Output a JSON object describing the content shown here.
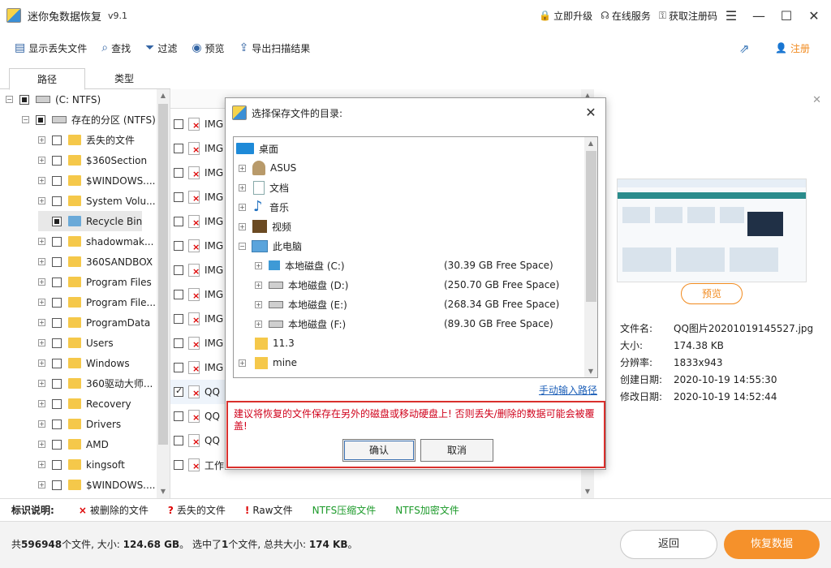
{
  "app": {
    "title": "迷你兔数据恢复",
    "version": "v9.1",
    "actions": [
      {
        "label": "立即升级",
        "icon": "lock-icon"
      },
      {
        "label": "在线服务",
        "icon": "headset-icon"
      },
      {
        "label": "获取注册码",
        "icon": "key-icon"
      }
    ]
  },
  "toolbar": {
    "show_lost": "显示丢失文件",
    "find": "查找",
    "filter": "过滤",
    "preview": "预览",
    "export": "导出扫描结果",
    "register": "注册"
  },
  "tabs": {
    "path": "路径",
    "type": "类型"
  },
  "tree": {
    "root": "(C: NTFS)",
    "partition": "存在的分区 (NTFS)",
    "items": [
      "丢失的文件",
      "$360Section",
      "$WINDOWS....",
      "System Volu...",
      "Recycle Bin",
      "shadowmak...",
      "360SANDBOX",
      "Program Files",
      "Program File...",
      "ProgramData",
      "Users",
      "Windows",
      "360驱动大师...",
      "Recovery",
      "Drivers",
      "AMD",
      "kingsoft",
      "$WINDOWS...."
    ]
  },
  "filelist": {
    "rows": [
      "IMG",
      "IMG",
      "IMG",
      "IMG",
      "IMG",
      "IMG",
      "IMG",
      "IMG",
      "IMG",
      "IMG",
      "IMG",
      "QQ",
      "QQ",
      "QQ",
      "工作"
    ]
  },
  "preview": {
    "button": "预览",
    "name_label": "文件名:",
    "name": "QQ图片20201019145527.jpg",
    "size_label": "大小:",
    "size": "174.38 KB",
    "res_label": "分辨率:",
    "res": "1833x943",
    "created_label": "创建日期:",
    "created": "2020-10-19 14:55:30",
    "modified_label": "修改日期:",
    "modified": "2020-10-19 14:52:44"
  },
  "legend": {
    "title": "标识说明:",
    "deleted": "被删除的文件",
    "lost": "丢失的文件",
    "raw": "Raw文件",
    "ntfs_compressed": "NTFS压缩文件",
    "ntfs_encrypted": "NTFS加密文件"
  },
  "status": {
    "prefix": "共",
    "count": "596948",
    "mid1": "个文件, 大小:",
    "total_size": "124.68 GB",
    "mid2": "。 选中了",
    "selected": "1",
    "mid3": "个文件, 总共大小:",
    "selected_size": "174 KB",
    "suffix": "。"
  },
  "buttons": {
    "back": "返回",
    "recover": "恢复数据"
  },
  "dialog": {
    "title": "选择保存文件的目录:",
    "desktop": "桌面",
    "nodes": [
      "ASUS",
      "文档",
      "音乐",
      "视频",
      "此电脑"
    ],
    "drives": [
      {
        "label": "本地磁盘 (C:)",
        "free": "(30.39 GB Free Space)"
      },
      {
        "label": "本地磁盘 (D:)",
        "free": "(250.70 GB Free Space)"
      },
      {
        "label": "本地磁盘 (E:)",
        "free": "(268.34 GB Free Space)"
      },
      {
        "label": "本地磁盘 (F:)",
        "free": "(89.30 GB Free Space)"
      }
    ],
    "folders": [
      "11.3",
      "mine"
    ],
    "manual": "手动输入路径",
    "warning": "建议将恢复的文件保存在另外的磁盘或移动硬盘上! 否则丢失/删除的数据可能会被覆盖!",
    "ok": "确认",
    "cancel": "取消"
  }
}
